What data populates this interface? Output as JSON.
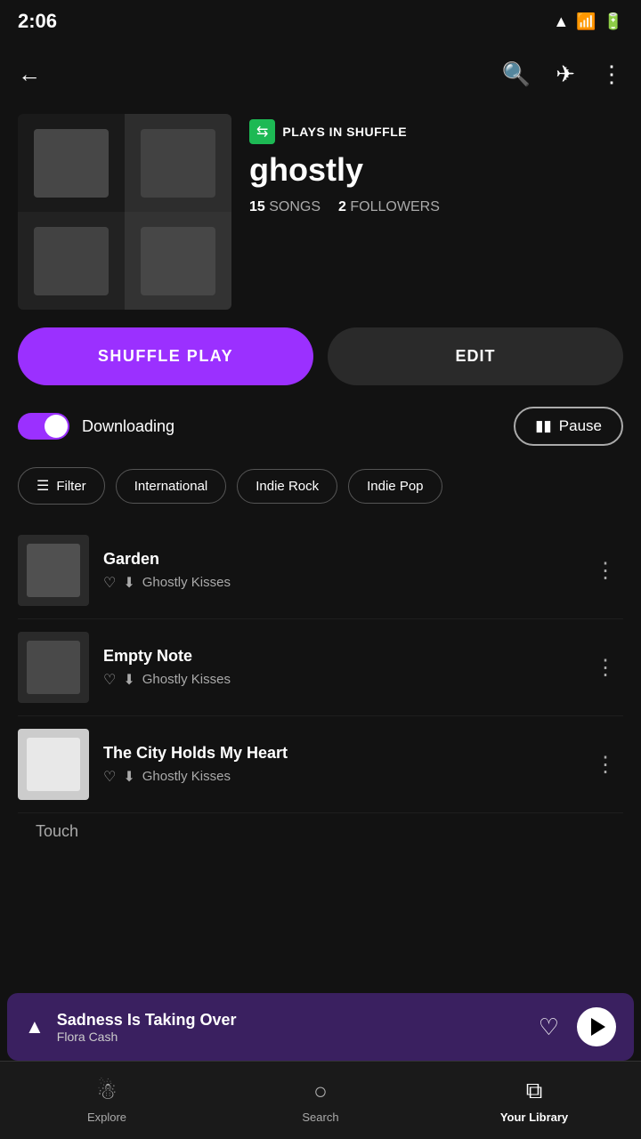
{
  "statusBar": {
    "time": "2:06",
    "icons": [
      "signal",
      "wifi",
      "battery"
    ]
  },
  "header": {
    "playlistBadge": "PLAYS IN SHUFFLE",
    "playlistTitle": "ghostly",
    "songCount": "15",
    "songsLabel": "SONGS",
    "followerCount": "2",
    "followersLabel": "FOLLOWERS"
  },
  "buttons": {
    "shufflePlay": "SHUFFLE PLAY",
    "edit": "EDIT"
  },
  "downloading": {
    "label": "Downloading",
    "pauseLabel": "Pause"
  },
  "filters": [
    {
      "id": "filter",
      "label": "Filter",
      "hasIcon": true
    },
    {
      "id": "international",
      "label": "International",
      "hasIcon": false
    },
    {
      "id": "indie-rock",
      "label": "Indie Rock",
      "hasIcon": false
    },
    {
      "id": "indie-pop",
      "label": "Indie Pop",
      "hasIcon": false
    }
  ],
  "songs": [
    {
      "title": "Garden",
      "artist": "Ghostly Kisses",
      "artStyle": "dark"
    },
    {
      "title": "Empty Note",
      "artist": "Ghostly Kisses",
      "artStyle": "dark"
    },
    {
      "title": "The City Holds My Heart",
      "artist": "Ghostly Kisses",
      "artStyle": "light"
    }
  ],
  "miniPlayer": {
    "chevron": "▲",
    "title": "Sadness Is Taking Over",
    "artist": "Flora Cash"
  },
  "peekSong": "Touch",
  "tabs": [
    {
      "id": "explore",
      "label": "Explore",
      "icon": "explore",
      "active": false
    },
    {
      "id": "search",
      "label": "Search",
      "icon": "search",
      "active": false
    },
    {
      "id": "library",
      "label": "Your Library",
      "icon": "library",
      "active": true
    }
  ]
}
